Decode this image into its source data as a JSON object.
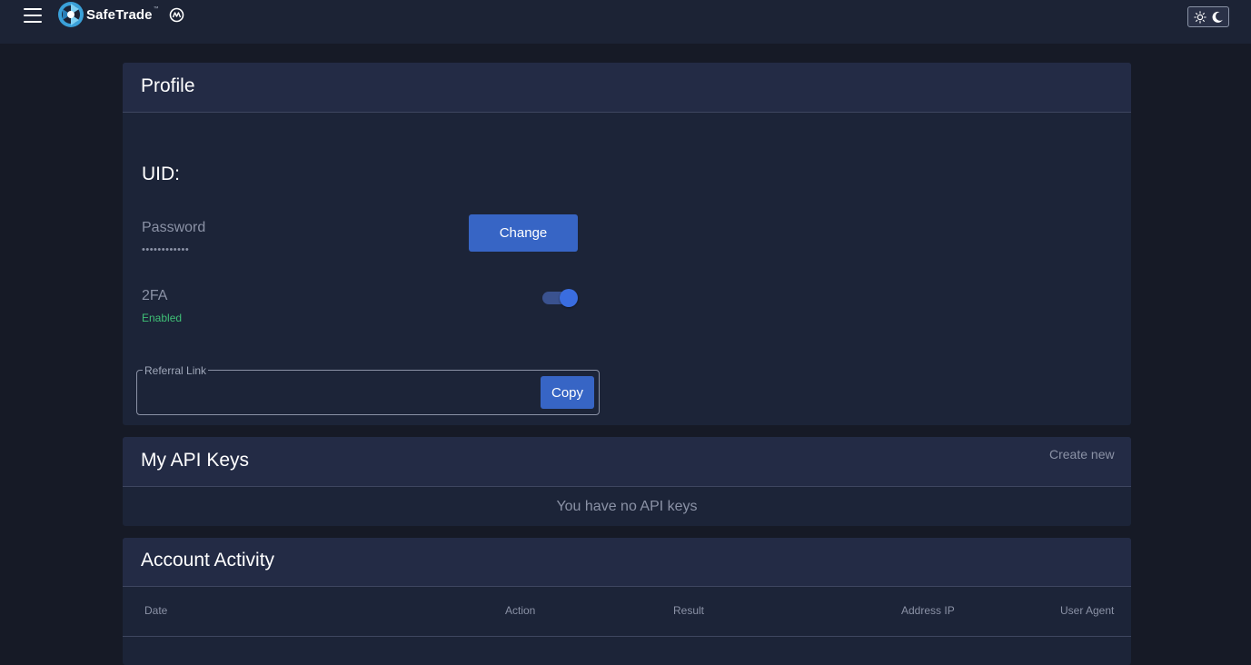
{
  "brand": {
    "name": "SafeTrade",
    "tm": "™",
    "accent": "#3765c5",
    "success": "#3fbf76"
  },
  "icons": {
    "menu": "hamburger-menu-icon",
    "logo": "safetrade-logo-icon",
    "partner": "coinmarketcap-icon",
    "light": "sun-icon",
    "dark": "moon-icon"
  },
  "profile": {
    "title": "Profile",
    "uid_label": "UID:",
    "password_label": "Password",
    "password_value": "••••••••••••",
    "change_label": "Change",
    "tfa_label": "2FA",
    "tfa_status": "Enabled",
    "tfa_enabled": true,
    "referral_label": "Referral Link",
    "referral_value": "",
    "copy_label": "Copy"
  },
  "api_keys": {
    "title": "My API Keys",
    "create_label": "Create new",
    "empty_text": "You have no API keys"
  },
  "activity": {
    "title": "Account Activity",
    "columns": [
      "Date",
      "Action",
      "Result",
      "Address IP",
      "User Agent"
    ]
  }
}
